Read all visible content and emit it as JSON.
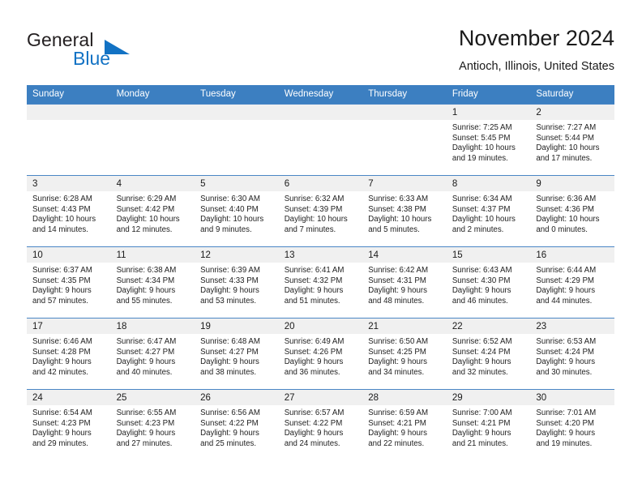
{
  "branding": {
    "name_part1": "General",
    "name_part2": "Blue",
    "accent_color": "#1272c4"
  },
  "header": {
    "title": "November 2024",
    "location": "Antioch, Illinois, United States"
  },
  "calendar": {
    "weekdays": [
      "Sunday",
      "Monday",
      "Tuesday",
      "Wednesday",
      "Thursday",
      "Friday",
      "Saturday"
    ],
    "header_background": "#3c7fc1",
    "daynum_background": "#f0f0f0",
    "labels": {
      "sunrise": "Sunrise:",
      "sunset": "Sunset:",
      "daylight": "Daylight:"
    },
    "weeks": [
      [
        null,
        null,
        null,
        null,
        null,
        {
          "day": "1",
          "sunrise": "Sunrise: 7:25 AM",
          "sunset": "Sunset: 5:45 PM",
          "daylight_line1": "Daylight: 10 hours",
          "daylight_line2": "and 19 minutes."
        },
        {
          "day": "2",
          "sunrise": "Sunrise: 7:27 AM",
          "sunset": "Sunset: 5:44 PM",
          "daylight_line1": "Daylight: 10 hours",
          "daylight_line2": "and 17 minutes."
        }
      ],
      [
        {
          "day": "3",
          "sunrise": "Sunrise: 6:28 AM",
          "sunset": "Sunset: 4:43 PM",
          "daylight_line1": "Daylight: 10 hours",
          "daylight_line2": "and 14 minutes."
        },
        {
          "day": "4",
          "sunrise": "Sunrise: 6:29 AM",
          "sunset": "Sunset: 4:42 PM",
          "daylight_line1": "Daylight: 10 hours",
          "daylight_line2": "and 12 minutes."
        },
        {
          "day": "5",
          "sunrise": "Sunrise: 6:30 AM",
          "sunset": "Sunset: 4:40 PM",
          "daylight_line1": "Daylight: 10 hours",
          "daylight_line2": "and 9 minutes."
        },
        {
          "day": "6",
          "sunrise": "Sunrise: 6:32 AM",
          "sunset": "Sunset: 4:39 PM",
          "daylight_line1": "Daylight: 10 hours",
          "daylight_line2": "and 7 minutes."
        },
        {
          "day": "7",
          "sunrise": "Sunrise: 6:33 AM",
          "sunset": "Sunset: 4:38 PM",
          "daylight_line1": "Daylight: 10 hours",
          "daylight_line2": "and 5 minutes."
        },
        {
          "day": "8",
          "sunrise": "Sunrise: 6:34 AM",
          "sunset": "Sunset: 4:37 PM",
          "daylight_line1": "Daylight: 10 hours",
          "daylight_line2": "and 2 minutes."
        },
        {
          "day": "9",
          "sunrise": "Sunrise: 6:36 AM",
          "sunset": "Sunset: 4:36 PM",
          "daylight_line1": "Daylight: 10 hours",
          "daylight_line2": "and 0 minutes."
        }
      ],
      [
        {
          "day": "10",
          "sunrise": "Sunrise: 6:37 AM",
          "sunset": "Sunset: 4:35 PM",
          "daylight_line1": "Daylight: 9 hours",
          "daylight_line2": "and 57 minutes."
        },
        {
          "day": "11",
          "sunrise": "Sunrise: 6:38 AM",
          "sunset": "Sunset: 4:34 PM",
          "daylight_line1": "Daylight: 9 hours",
          "daylight_line2": "and 55 minutes."
        },
        {
          "day": "12",
          "sunrise": "Sunrise: 6:39 AM",
          "sunset": "Sunset: 4:33 PM",
          "daylight_line1": "Daylight: 9 hours",
          "daylight_line2": "and 53 minutes."
        },
        {
          "day": "13",
          "sunrise": "Sunrise: 6:41 AM",
          "sunset": "Sunset: 4:32 PM",
          "daylight_line1": "Daylight: 9 hours",
          "daylight_line2": "and 51 minutes."
        },
        {
          "day": "14",
          "sunrise": "Sunrise: 6:42 AM",
          "sunset": "Sunset: 4:31 PM",
          "daylight_line1": "Daylight: 9 hours",
          "daylight_line2": "and 48 minutes."
        },
        {
          "day": "15",
          "sunrise": "Sunrise: 6:43 AM",
          "sunset": "Sunset: 4:30 PM",
          "daylight_line1": "Daylight: 9 hours",
          "daylight_line2": "and 46 minutes."
        },
        {
          "day": "16",
          "sunrise": "Sunrise: 6:44 AM",
          "sunset": "Sunset: 4:29 PM",
          "daylight_line1": "Daylight: 9 hours",
          "daylight_line2": "and 44 minutes."
        }
      ],
      [
        {
          "day": "17",
          "sunrise": "Sunrise: 6:46 AM",
          "sunset": "Sunset: 4:28 PM",
          "daylight_line1": "Daylight: 9 hours",
          "daylight_line2": "and 42 minutes."
        },
        {
          "day": "18",
          "sunrise": "Sunrise: 6:47 AM",
          "sunset": "Sunset: 4:27 PM",
          "daylight_line1": "Daylight: 9 hours",
          "daylight_line2": "and 40 minutes."
        },
        {
          "day": "19",
          "sunrise": "Sunrise: 6:48 AM",
          "sunset": "Sunset: 4:27 PM",
          "daylight_line1": "Daylight: 9 hours",
          "daylight_line2": "and 38 minutes."
        },
        {
          "day": "20",
          "sunrise": "Sunrise: 6:49 AM",
          "sunset": "Sunset: 4:26 PM",
          "daylight_line1": "Daylight: 9 hours",
          "daylight_line2": "and 36 minutes."
        },
        {
          "day": "21",
          "sunrise": "Sunrise: 6:50 AM",
          "sunset": "Sunset: 4:25 PM",
          "daylight_line1": "Daylight: 9 hours",
          "daylight_line2": "and 34 minutes."
        },
        {
          "day": "22",
          "sunrise": "Sunrise: 6:52 AM",
          "sunset": "Sunset: 4:24 PM",
          "daylight_line1": "Daylight: 9 hours",
          "daylight_line2": "and 32 minutes."
        },
        {
          "day": "23",
          "sunrise": "Sunrise: 6:53 AM",
          "sunset": "Sunset: 4:24 PM",
          "daylight_line1": "Daylight: 9 hours",
          "daylight_line2": "and 30 minutes."
        }
      ],
      [
        {
          "day": "24",
          "sunrise": "Sunrise: 6:54 AM",
          "sunset": "Sunset: 4:23 PM",
          "daylight_line1": "Daylight: 9 hours",
          "daylight_line2": "and 29 minutes."
        },
        {
          "day": "25",
          "sunrise": "Sunrise: 6:55 AM",
          "sunset": "Sunset: 4:23 PM",
          "daylight_line1": "Daylight: 9 hours",
          "daylight_line2": "and 27 minutes."
        },
        {
          "day": "26",
          "sunrise": "Sunrise: 6:56 AM",
          "sunset": "Sunset: 4:22 PM",
          "daylight_line1": "Daylight: 9 hours",
          "daylight_line2": "and 25 minutes."
        },
        {
          "day": "27",
          "sunrise": "Sunrise: 6:57 AM",
          "sunset": "Sunset: 4:22 PM",
          "daylight_line1": "Daylight: 9 hours",
          "daylight_line2": "and 24 minutes."
        },
        {
          "day": "28",
          "sunrise": "Sunrise: 6:59 AM",
          "sunset": "Sunset: 4:21 PM",
          "daylight_line1": "Daylight: 9 hours",
          "daylight_line2": "and 22 minutes."
        },
        {
          "day": "29",
          "sunrise": "Sunrise: 7:00 AM",
          "sunset": "Sunset: 4:21 PM",
          "daylight_line1": "Daylight: 9 hours",
          "daylight_line2": "and 21 minutes."
        },
        {
          "day": "30",
          "sunrise": "Sunrise: 7:01 AM",
          "sunset": "Sunset: 4:20 PM",
          "daylight_line1": "Daylight: 9 hours",
          "daylight_line2": "and 19 minutes."
        }
      ]
    ]
  }
}
